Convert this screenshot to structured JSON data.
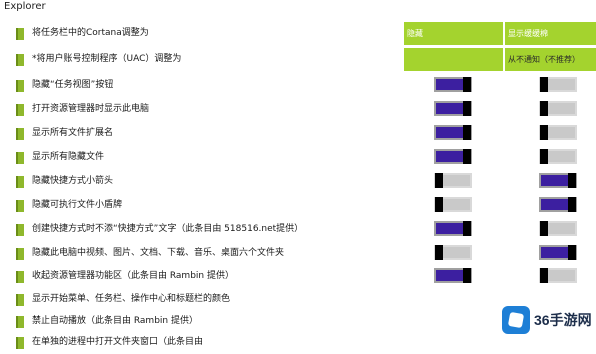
{
  "window": {
    "title": "Explorer"
  },
  "columns": {
    "col1_header": "隐藏",
    "col2_header": "显示缓缓棉",
    "row2_col2": "从不通知（不推荐）"
  },
  "accent_colors": {
    "header_bg": "#a4d32e",
    "toggle_on": "#3c1fa0",
    "toggle_off": "#c9c9c9",
    "bullet": "#8fb82c"
  },
  "settings": [
    {
      "label": "将任务栏中的Cortana调整为"
    },
    {
      "label": "*将用户账号控制程序（UAC）调整为"
    },
    {
      "label": "隐藏“任务视图”按钮",
      "c1": "on",
      "c2": "off"
    },
    {
      "label": "打开资源管理器时显示此电脑",
      "c1": "on",
      "c2": "off"
    },
    {
      "label": "显示所有文件扩展名",
      "c1": "on",
      "c2": "off"
    },
    {
      "label": "显示所有隐藏文件",
      "c1": "on",
      "c2": "off"
    },
    {
      "label": "隐藏快捷方式小箭头",
      "c1": "off",
      "c2": "on"
    },
    {
      "label": "隐藏可执行文件小盾牌",
      "c1": "off",
      "c2": "on"
    },
    {
      "label": "创建快捷方式时不添“快捷方式”文字（此条目由 518516.net提供）",
      "c1": "on",
      "c2": "off"
    },
    {
      "label": "隐藏此电脑中视频、图片、文档、下载、音乐、桌面六个文件夹",
      "c1": "off",
      "c2": "on"
    },
    {
      "label": "收起资源管理器功能区（此条目由 Rambin 提供）",
      "c1": "on",
      "c2": "off"
    },
    {
      "label": "显示开始菜单、任务栏、操作中心和标题栏的颜色"
    },
    {
      "label": "禁止自动播放（此条目由 Rambin 提供）"
    },
    {
      "label": "在单独的进程中打开文件夹窗口（此条目由"
    }
  ],
  "watermark": {
    "text": "36手游网",
    "icon": "36shouyou-logo"
  }
}
